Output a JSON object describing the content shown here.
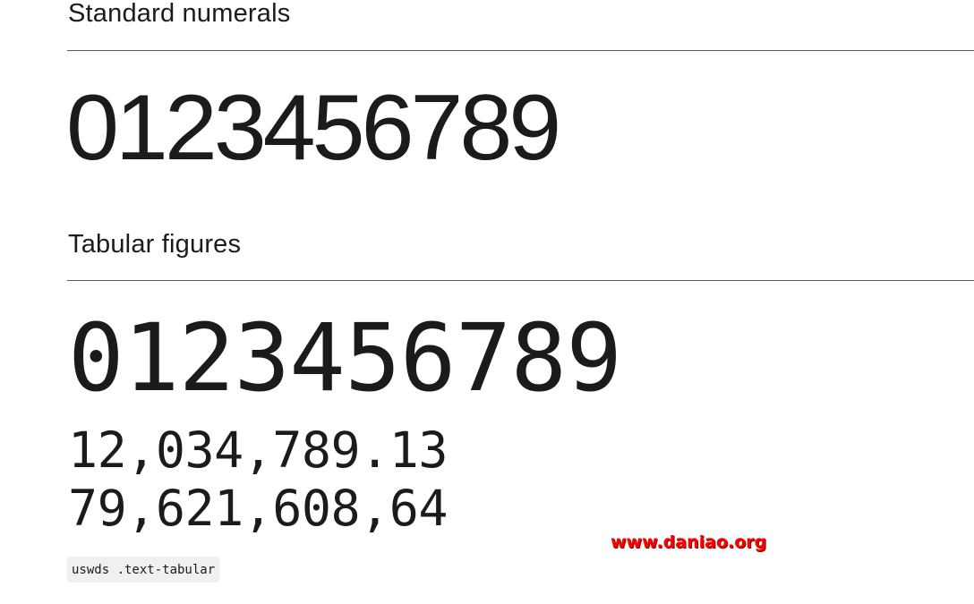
{
  "standard": {
    "heading": "Standard numerals",
    "numerals": "0123456789"
  },
  "tabular": {
    "heading": "Tabular figures",
    "numerals": "0123456789",
    "line_1": "12,034,789.13",
    "line_2": "79,621,608,64"
  },
  "code_chip": {
    "label": "uswds .text-tabular"
  },
  "watermark": {
    "text": "www.daniao.org",
    "color": "#ff0000"
  }
}
